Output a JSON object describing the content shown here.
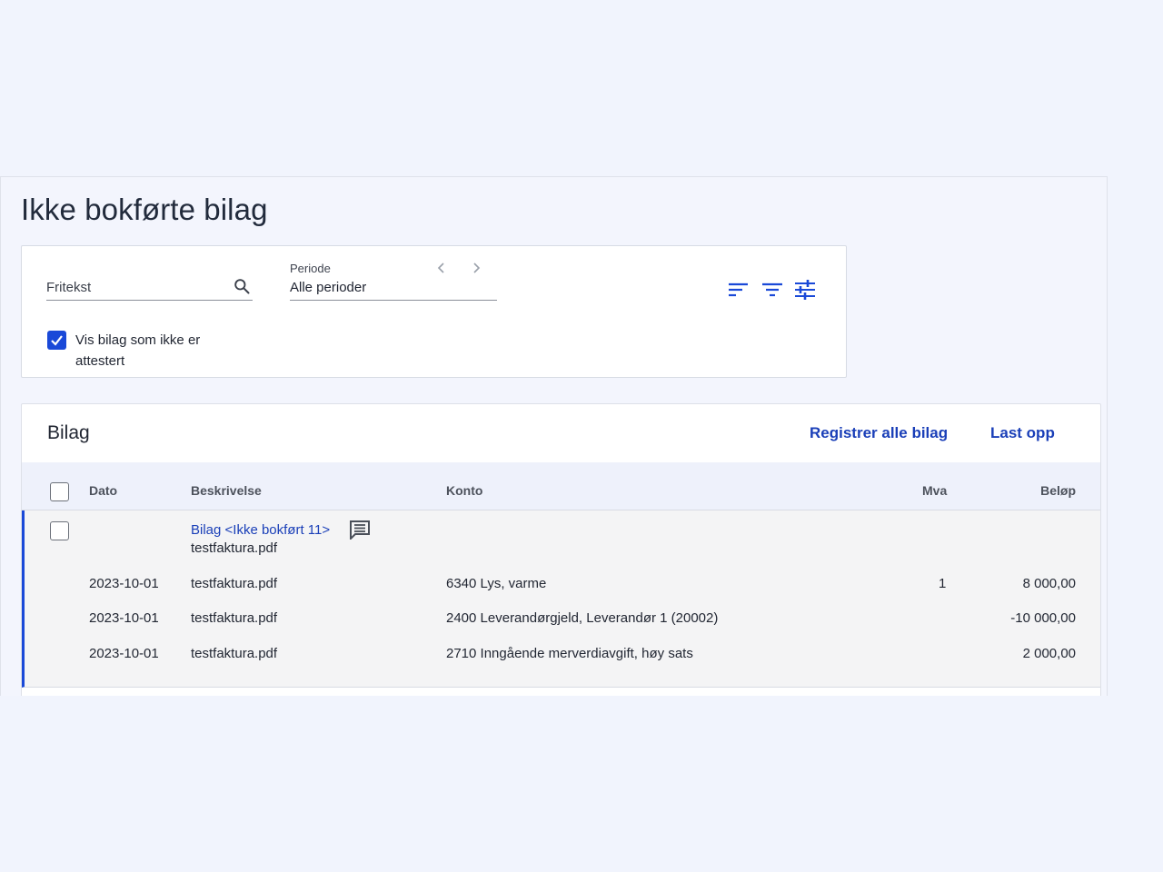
{
  "page": {
    "title": "Ikke bokførte bilag"
  },
  "filters": {
    "search_placeholder": "Fritekst",
    "periode_label": "Periode",
    "periode_value": "Alle perioder",
    "checkbox_label": "Vis bilag som ikke er attestert",
    "checkbox_checked": true
  },
  "list": {
    "title": "Bilag",
    "actions": {
      "register_all": "Registrer alle bilag",
      "upload": "Last opp"
    },
    "columns": {
      "dato": "Dato",
      "beskrivelse": "Beskrivelse",
      "konto": "Konto",
      "mva": "Mva",
      "belop": "Beløp"
    },
    "group": {
      "link": "Bilag <Ikke bokført 11>",
      "filename": "testfaktura.pdf",
      "rows": [
        {
          "dato": "2023-10-01",
          "beskrivelse": "testfaktura.pdf",
          "konto": "6340 Lys, varme",
          "mva": "1",
          "belop": "8 000,00"
        },
        {
          "dato": "2023-10-01",
          "beskrivelse": "testfaktura.pdf",
          "konto": "2400 Leverandørgjeld, Leverandør 1 (20002)",
          "mva": "",
          "belop": "-10 000,00"
        },
        {
          "dato": "2023-10-01",
          "beskrivelse": "testfaktura.pdf",
          "konto": "2710 Inngående merverdiavgift, høy sats",
          "mva": "",
          "belop": "2 000,00"
        }
      ]
    }
  },
  "colors": {
    "accent": "#1a49d8",
    "link": "#1a3fb8",
    "background": "#f1f4fd"
  }
}
